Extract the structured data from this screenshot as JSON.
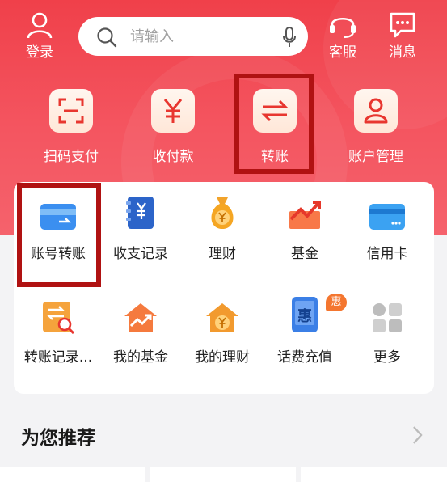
{
  "header": {
    "login_label": "登录",
    "service_label": "客服",
    "messages_label": "消息",
    "search_placeholder": "请输入"
  },
  "quick_actions": [
    {
      "label": "扫码支付",
      "icon": "scan-icon"
    },
    {
      "label": "收付款",
      "icon": "yuan-icon"
    },
    {
      "label": "转账",
      "icon": "transfer-arrows-icon"
    },
    {
      "label": "账户管理",
      "icon": "person-icon"
    }
  ],
  "grid": [
    {
      "label": "账号转账",
      "icon": "card-transfer-icon"
    },
    {
      "label": "收支记录",
      "icon": "ledger-icon"
    },
    {
      "label": "理财",
      "icon": "money-bag-icon"
    },
    {
      "label": "基金",
      "icon": "chart-up-icon"
    },
    {
      "label": "信用卡",
      "icon": "credit-card-icon"
    },
    {
      "label": "转账记录...",
      "icon": "transfer-search-icon"
    },
    {
      "label": "我的基金",
      "icon": "house-chart-icon"
    },
    {
      "label": "我的理财",
      "icon": "house-yuan-icon"
    },
    {
      "label": "话费充值",
      "icon": "phone-recharge-icon",
      "badge": "惠",
      "screen_text": "惠"
    },
    {
      "label": "更多",
      "icon": "more-grid-icon"
    }
  ],
  "recommend": {
    "title": "为您推荐"
  },
  "colors": {
    "brand_red": "#f0404a",
    "highlight": "#b01212"
  }
}
